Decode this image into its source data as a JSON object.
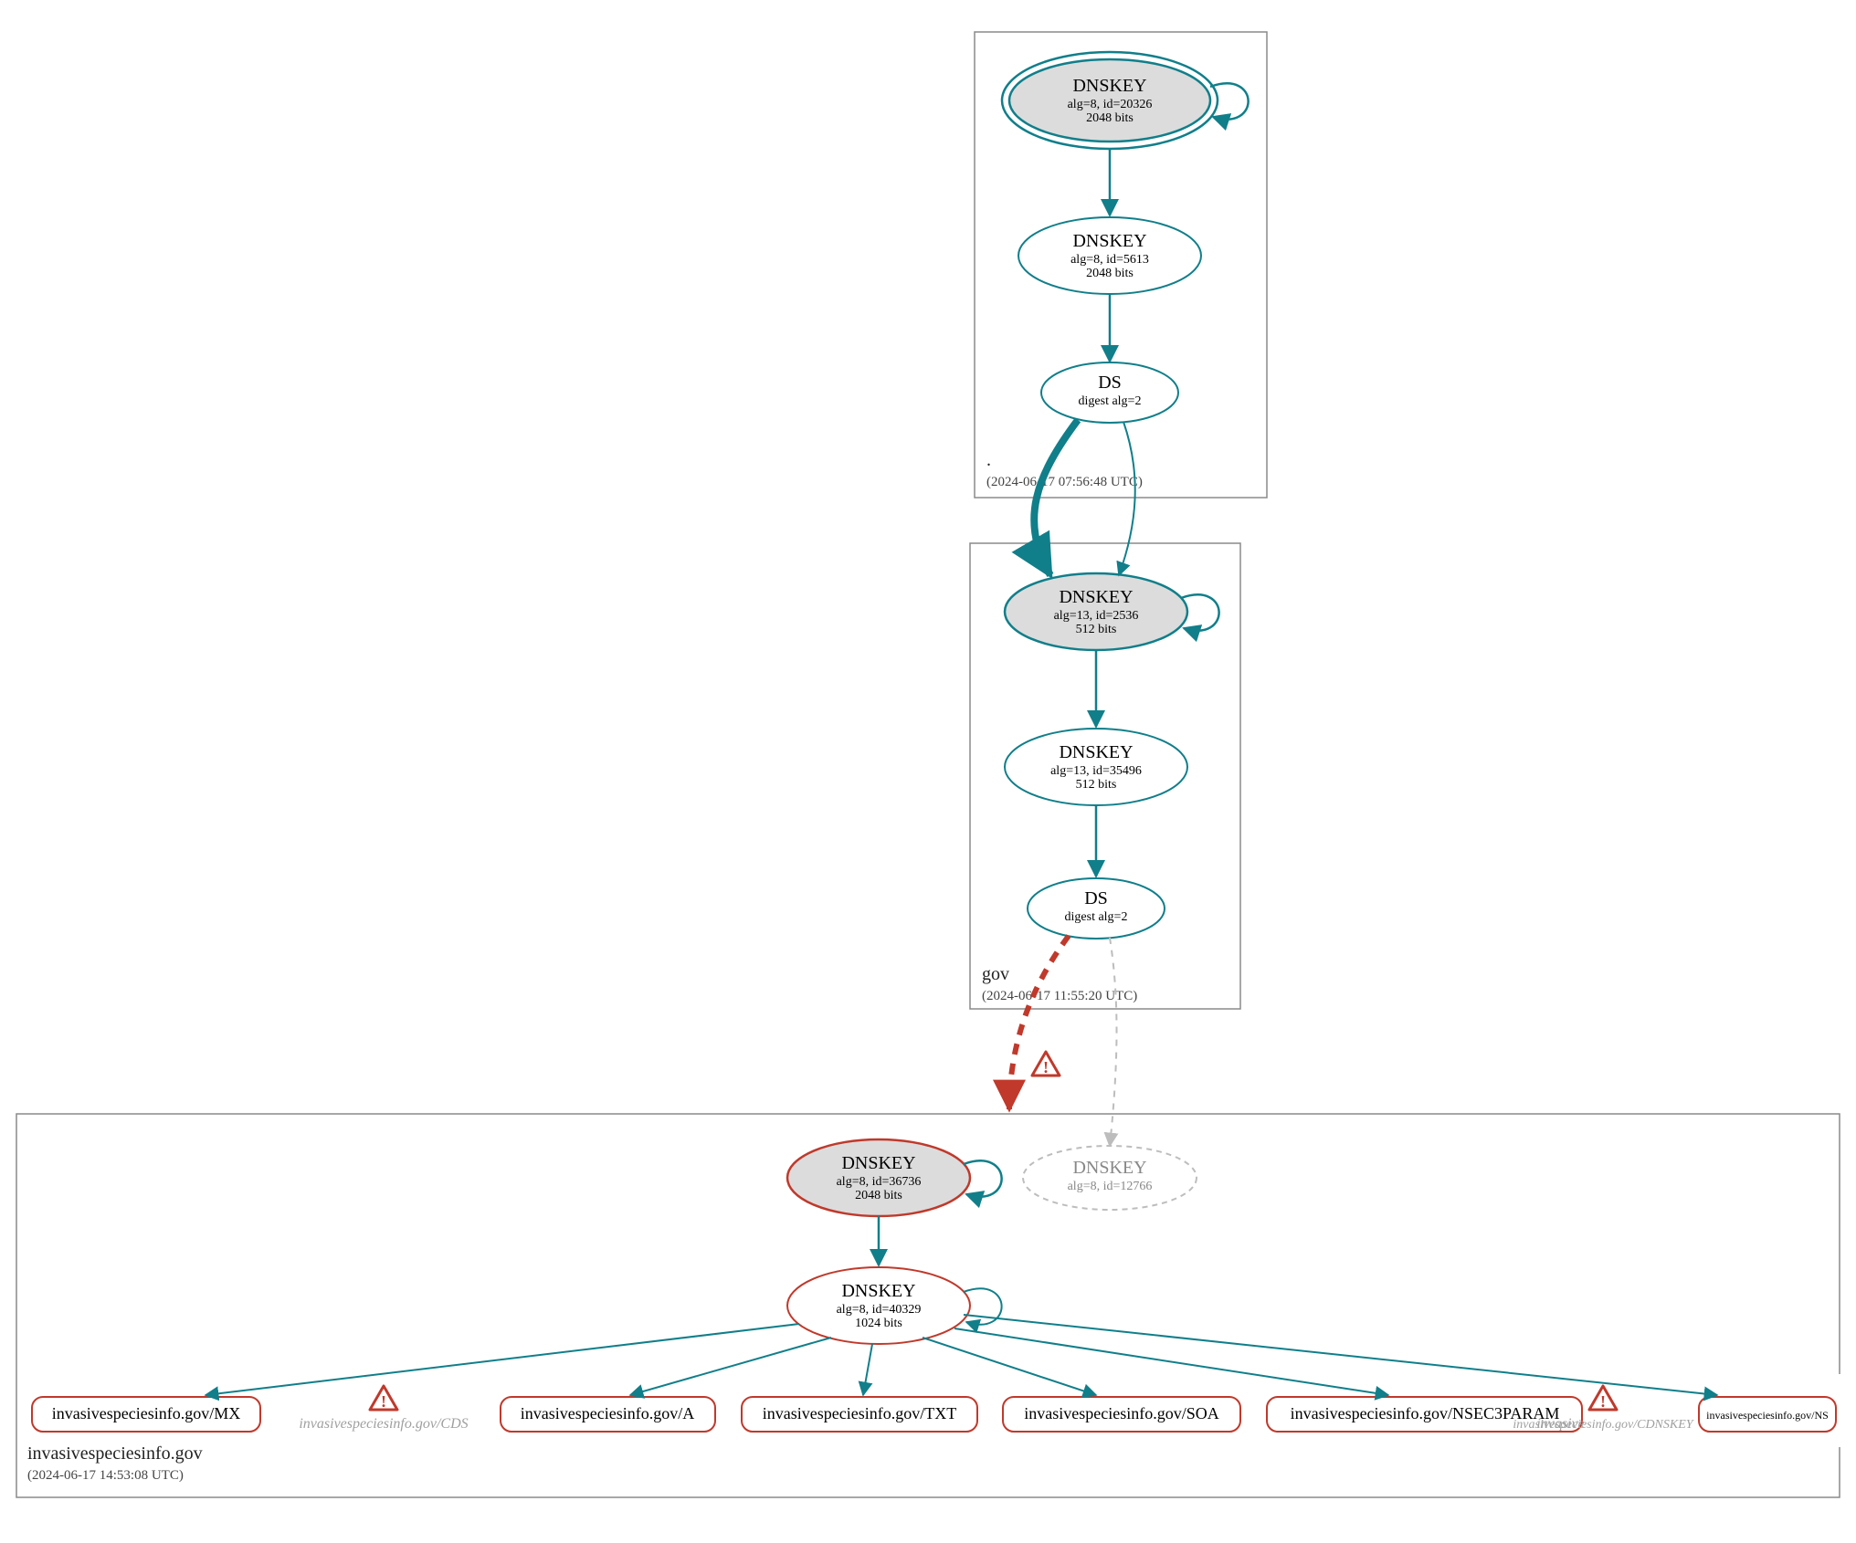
{
  "zones": {
    "root": {
      "label": ".",
      "timestamp": "(2024-06-17 07:56:48 UTC)"
    },
    "gov": {
      "label": "gov",
      "timestamp": "(2024-06-17 11:55:20 UTC)"
    },
    "domain": {
      "label": "invasivespeciesinfo.gov",
      "timestamp": "(2024-06-17 14:53:08 UTC)"
    }
  },
  "nodes": {
    "root_ksk": {
      "title": "DNSKEY",
      "line1": "alg=8, id=20326",
      "line2": "2048 bits"
    },
    "root_zsk": {
      "title": "DNSKEY",
      "line1": "alg=8, id=5613",
      "line2": "2048 bits"
    },
    "root_ds": {
      "title": "DS",
      "line1": "digest alg=2"
    },
    "gov_ksk": {
      "title": "DNSKEY",
      "line1": "alg=13, id=2536",
      "line2": "512 bits"
    },
    "gov_zsk": {
      "title": "DNSKEY",
      "line1": "alg=13, id=35496",
      "line2": "512 bits"
    },
    "gov_ds": {
      "title": "DS",
      "line1": "digest alg=2"
    },
    "dom_ksk": {
      "title": "DNSKEY",
      "line1": "alg=8, id=36736",
      "line2": "2048 bits"
    },
    "dom_ghost": {
      "title": "DNSKEY",
      "line1": "alg=8, id=12766"
    },
    "dom_zsk": {
      "title": "DNSKEY",
      "line1": "alg=8, id=40329",
      "line2": "1024 bits"
    }
  },
  "records": {
    "mx": "invasivespeciesinfo.gov/MX",
    "cds": "invasivespeciesinfo.gov/CDS",
    "a": "invasivespeciesinfo.gov/A",
    "txt": "invasivespeciesinfo.gov/TXT",
    "soa": "invasivespeciesinfo.gov/SOA",
    "nsec3": "invasivespeciesinfo.gov/NSEC3PARAM",
    "cdnskey": "invasivespeciesinfo.gov/CDNSKEY",
    "ns": "invasivespeciesinfo.gov/NS"
  }
}
